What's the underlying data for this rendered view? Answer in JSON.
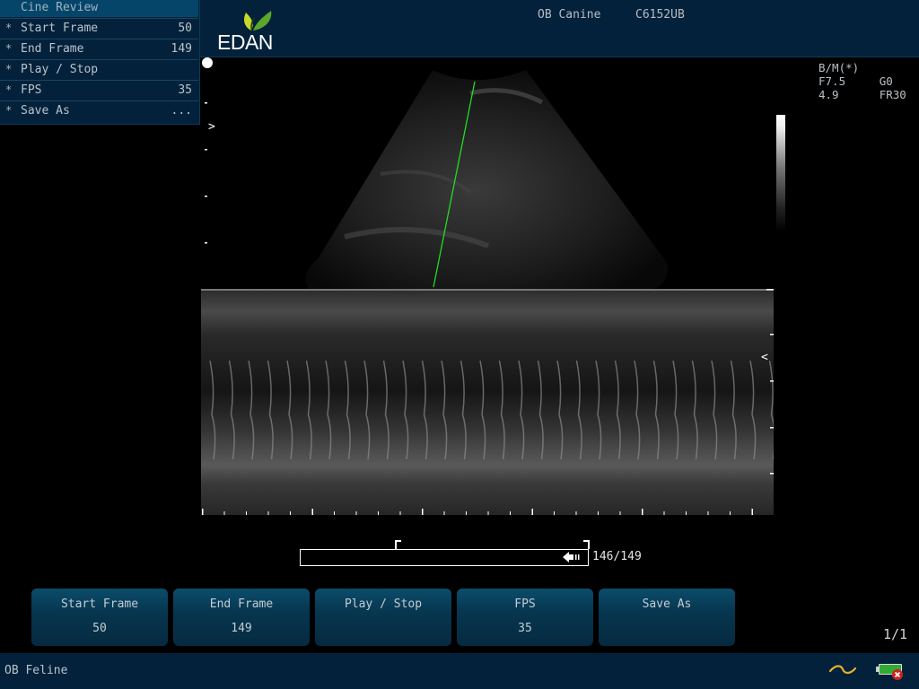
{
  "header": {
    "brand": "EDAN",
    "exam_type": "OB Canine",
    "probe": "C6152UB"
  },
  "side_menu": {
    "title": "Cine Review",
    "items": [
      {
        "marker": "*",
        "label": "Start Frame",
        "value": "50"
      },
      {
        "marker": "*",
        "label": "End Frame",
        "value": "149"
      },
      {
        "marker": "*",
        "label": "Play / Stop",
        "value": ""
      },
      {
        "marker": "*",
        "label": "FPS",
        "value": "35"
      },
      {
        "marker": "*",
        "label": "Save As",
        "value": "..."
      }
    ]
  },
  "image_params": {
    "mode": "B/M(*)",
    "frequency": "F7.5",
    "gain": "G0",
    "depth": "4.9",
    "frame_rate": "FR30"
  },
  "image_markers": {
    "focus_marker": ">",
    "m_mode_marker": "<"
  },
  "cine": {
    "current_frame": 146,
    "total_frames": 149,
    "counter_text": "146/149",
    "review_start_frame": 50,
    "review_end_frame": 149
  },
  "soft_buttons": [
    {
      "label": "Start Frame",
      "value": "50"
    },
    {
      "label": "End Frame",
      "value": "149"
    },
    {
      "label": "Play / Stop",
      "value": ""
    },
    {
      "label": "FPS",
      "value": "35"
    },
    {
      "label": "Save As",
      "value": ""
    }
  ],
  "page_indicator": "1/1",
  "status_bar": {
    "preset": "OB Feline",
    "icons": [
      "ac-power-icon",
      "battery-error-icon"
    ]
  },
  "colors": {
    "panel_bg": "#03213a",
    "menu_title_bg": "#06456a",
    "m_line": "#22dd22",
    "ac_icon": "#e0b030",
    "battery_green": "#33aa33",
    "battery_error": "#cc2222"
  }
}
